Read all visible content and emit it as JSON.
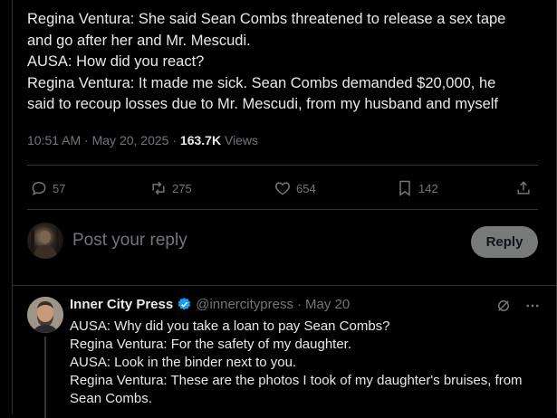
{
  "main_tweet": {
    "lines": [
      "Regina Ventura: She said Sean Combs threatened to release a sex tape",
      "and go after her and Mr. Mescudi.",
      "AUSA: How did you react?",
      "Regina Ventura: It made me sick. Sean Combs demanded $20,000, he",
      "said to recoup losses due to Mr. Mescudi, from my husband and myself"
    ],
    "time": "10:51 AM",
    "date": "May 20, 2025",
    "views_count": "163.7K",
    "views_label": "Views",
    "replies": "57",
    "reposts": "275",
    "likes": "654",
    "bookmarks": "142"
  },
  "composer": {
    "placeholder": "Post your reply",
    "button_label": "Reply"
  },
  "reply_tweet": {
    "name": "Inner City Press",
    "handle": "@innercitypress",
    "date": "May 20",
    "lines": [
      "AUSA: Why did you take a loan to pay Sean Combs?",
      "Regina Ventura: For the safety of my daughter.",
      "AUSA: Look in the binder next to you.",
      "Regina Ventura: These are the photos I took of my daughter's bruises, from",
      "Sean Combs."
    ]
  },
  "colors": {
    "background": "#000000",
    "text": "#e7e9ea",
    "muted": "#71767b",
    "divider": "#2f3336",
    "verified": "#1d9bf0",
    "reply_button": "#787a7a"
  },
  "icons": [
    "reply-icon",
    "repost-icon",
    "like-icon",
    "bookmark-icon",
    "share-icon",
    "verified-badge-icon",
    "grok-icon",
    "more-icon"
  ]
}
